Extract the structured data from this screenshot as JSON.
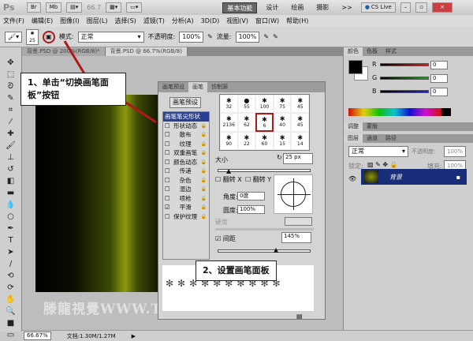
{
  "title_bar": {
    "app_logo": "Ps",
    "zoom": "66.7",
    "workspaces": [
      "基本功能",
      "设计",
      "绘画",
      "摄影",
      ">>"
    ],
    "active_workspace": "基本功能",
    "cs_live": "CS Live",
    "window_buttons": [
      "minimize",
      "restore",
      "close"
    ]
  },
  "menu": [
    "文件(F)",
    "编辑(E)",
    "图像(I)",
    "图层(L)",
    "选择(S)",
    "滤镜(T)",
    "分析(A)",
    "3D(D)",
    "视图(V)",
    "窗口(W)",
    "帮助(H)"
  ],
  "options_bar": {
    "brush_size": "25",
    "mode_label": "模式:",
    "mode_value": "正常",
    "opacity_label": "不透明度:",
    "opacity_value": "100%",
    "flow_label": "流量:",
    "flow_value": "100%"
  },
  "doc_tabs": [
    {
      "label": "背景.PSD @ 200%(RGB/8)*"
    },
    {
      "label": "背景.PSD @ 66.7%(RGB/8)"
    }
  ],
  "brush_panel": {
    "tabs": [
      "画笔预设",
      "画笔",
      "仿制源"
    ],
    "active_tab": "画笔",
    "preset_button": "画笔预设",
    "options": [
      {
        "label": "画笔笔尖形状",
        "checked": null,
        "selected": true
      },
      {
        "label": "形状动态",
        "checked": false
      },
      {
        "label": "散布",
        "checked": false
      },
      {
        "label": "纹理",
        "checked": false
      },
      {
        "label": "双重画笔",
        "checked": false
      },
      {
        "label": "颜色动态",
        "checked": false
      },
      {
        "label": "传递",
        "checked": false
      },
      {
        "label": "杂色",
        "checked": false
      },
      {
        "label": "湿边",
        "checked": false
      },
      {
        "label": "喷枪",
        "checked": false
      },
      {
        "label": "平滑",
        "checked": true
      },
      {
        "label": "保护纹理",
        "checked": false
      }
    ],
    "tips": [
      "32",
      "55",
      "100",
      "75",
      "45",
      "2136",
      "62",
      "6",
      "40",
      "45",
      "90",
      "22",
      "60",
      "15",
      "14"
    ],
    "selected_tip": "6",
    "size_label": "大小",
    "size_value": "25 px",
    "flip_x": "翻转 X",
    "flip_y": "翻转 Y",
    "angle_label": "角度:",
    "angle_value": "0度",
    "roundness_label": "圆度:",
    "roundness_value": "100%",
    "hardness_label": "硬度",
    "spacing_label": "间距",
    "spacing_checked": true,
    "spacing_value": "145%"
  },
  "color_panel": {
    "tabs": [
      "颜色",
      "色板",
      "样式"
    ],
    "channels": [
      {
        "label": "R",
        "value": "0",
        "color": "#d02020"
      },
      {
        "label": "G",
        "value": "0",
        "color": "#20a020"
      },
      {
        "label": "B",
        "value": "0",
        "color": "#2020c0"
      }
    ]
  },
  "adjust_panel": {
    "tabs": [
      "调整",
      "蒙版"
    ]
  },
  "layers_panel": {
    "tabs": [
      "图层",
      "通道",
      "路径"
    ],
    "blend_mode": "正常",
    "opacity_label": "不透明度:",
    "opacity_value": "100%",
    "lock_label": "锁定:",
    "fill_label": "填充:",
    "fill_value": "100%",
    "layers": [
      {
        "name": "背景",
        "selected": true
      }
    ]
  },
  "status_bar": {
    "zoom": "66.67%",
    "doc_info": "文档:1.30M/1.27M"
  },
  "callouts": {
    "step1": "1、单击“切换画笔面板”按钮",
    "step2": "2、设置画笔面板"
  },
  "watermark": "滕龍視覺WWW.TLVI.NET",
  "colors": {
    "highlight": "#b01818",
    "selection": "#2a3f8f",
    "layer_selected": "#1a2d7a"
  }
}
